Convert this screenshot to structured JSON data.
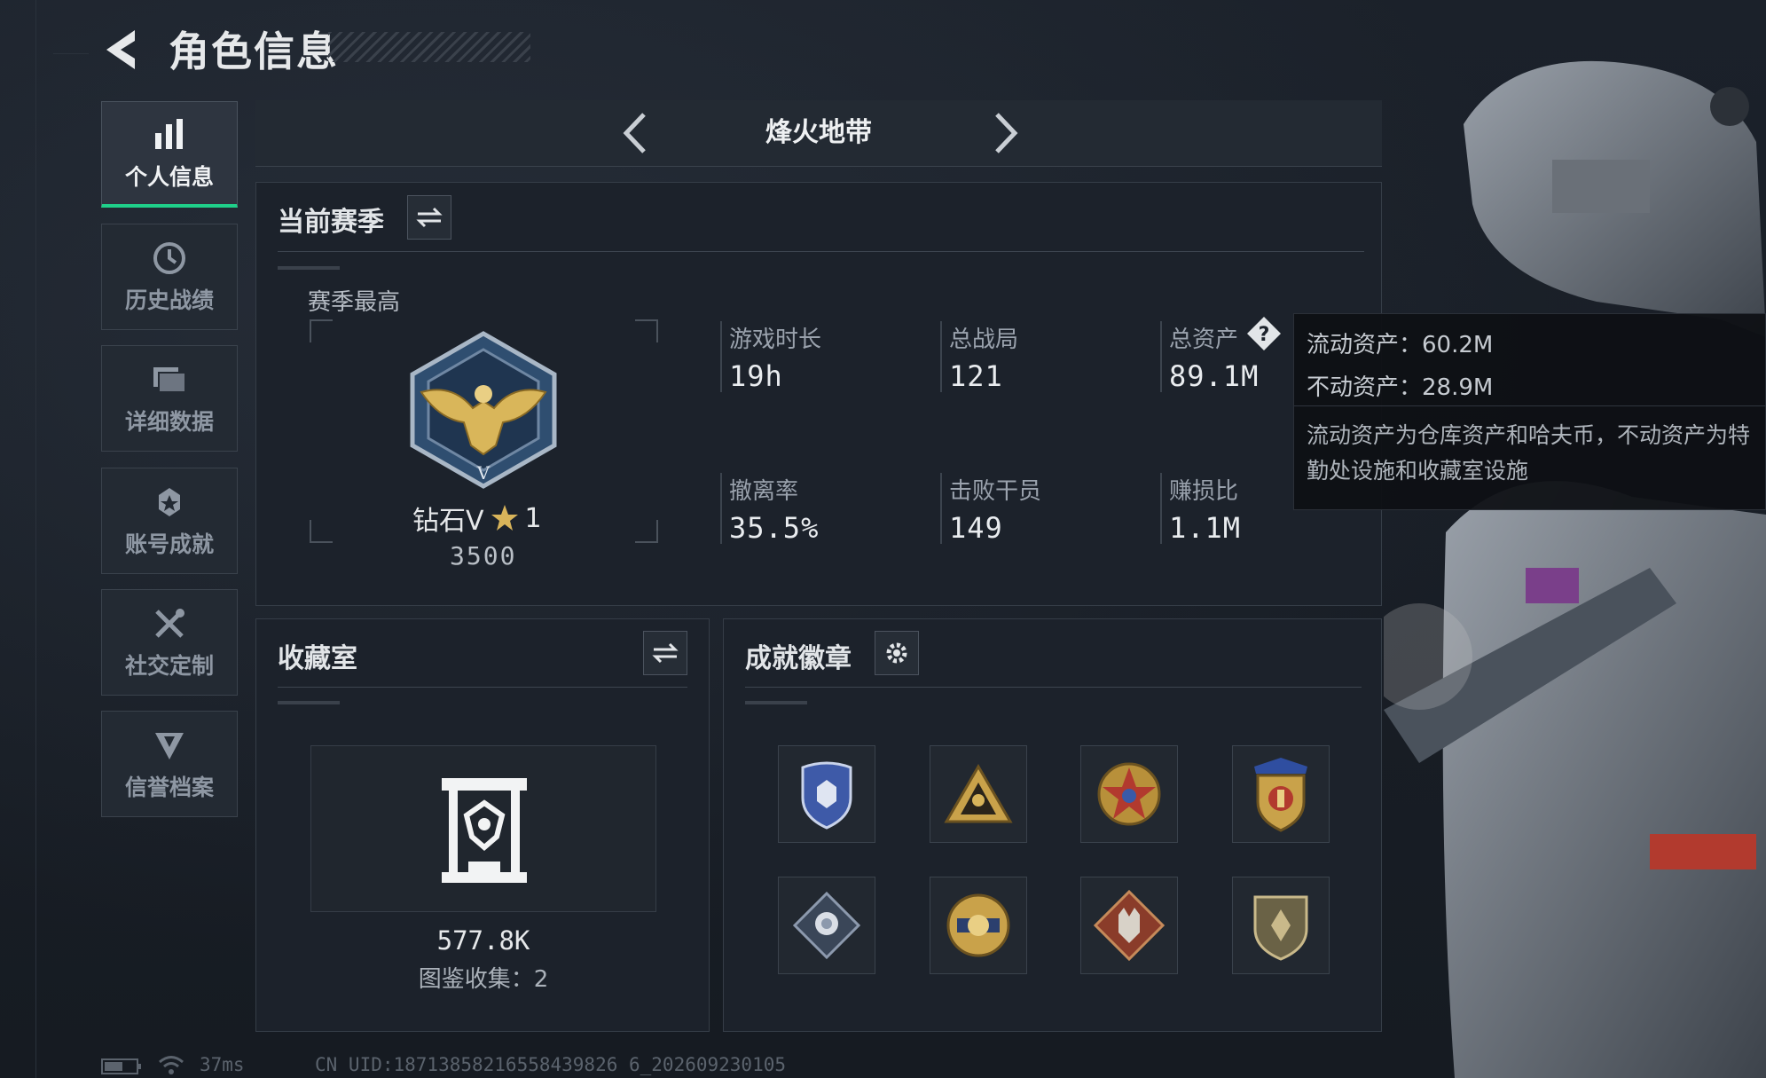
{
  "header": {
    "title": "角色信息"
  },
  "sidebar": {
    "items": [
      {
        "label": "个人信息",
        "icon": "bar-chart-icon",
        "active": true
      },
      {
        "label": "历史战绩",
        "icon": "clock-icon",
        "active": false
      },
      {
        "label": "详细数据",
        "icon": "folder-icon",
        "active": false
      },
      {
        "label": "账号成就",
        "icon": "achievement-icon",
        "active": false
      },
      {
        "label": "社交定制",
        "icon": "tools-icon",
        "active": false
      },
      {
        "label": "信誉档案",
        "icon": "shield-icon",
        "active": false
      }
    ]
  },
  "mode": {
    "name": "烽火地带"
  },
  "season": {
    "heading": "当前赛季",
    "best_label": "赛季最高",
    "rank_name": "钻石V",
    "rank_stars": "1",
    "rank_score": "3500",
    "stats": [
      {
        "label": "游戏时长",
        "value": "19h"
      },
      {
        "label": "总战局",
        "value": "121"
      },
      {
        "label": "总资产",
        "value": "89.1M"
      },
      {
        "label": "撤离率",
        "value": "35.5%"
      },
      {
        "label": "击败干员",
        "value": "149"
      },
      {
        "label": "赚损比",
        "value": "1.1M"
      }
    ]
  },
  "tooltip": {
    "liquid": "流动资产：60.2M",
    "fixed": "不动资产：28.9M",
    "note": "流动资产为仓库资产和哈夫币，不动资产为特勤处设施和收藏室设施"
  },
  "collection": {
    "heading": "收藏室",
    "value": "577.8K",
    "catalog": "图鉴收集：2"
  },
  "achievements": {
    "heading": "成就徽章",
    "badges": [
      "badge-blue-shield-icon",
      "badge-gold-triangle-icon",
      "badge-red-star-icon",
      "badge-eagle-crest-icon",
      "badge-diamond-rose-icon",
      "badge-gold-emblem-icon",
      "badge-wolf-icon",
      "badge-shield-icon"
    ]
  },
  "footer": {
    "ping": "37ms",
    "uid": "CN UID:18713858216558439826 6_202609230105"
  },
  "colors": {
    "accent": "#1fd08a",
    "background": "#171c24"
  }
}
